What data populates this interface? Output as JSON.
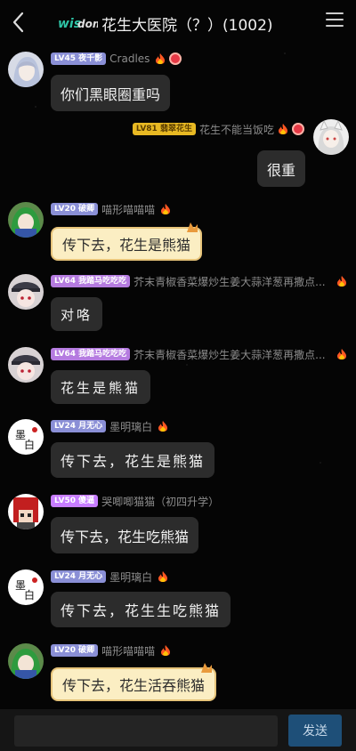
{
  "header": {
    "title": "花生大医院（？）(1002)",
    "logo_text": "wisdom"
  },
  "messages": [
    {
      "side": "left",
      "level": "LV45",
      "level_color": "#8a8fd6",
      "nick": "夜千影",
      "remark": "Cradles",
      "text": "你们黑眼圈重吗",
      "fire": true,
      "badge": true,
      "avatar": "avatar-girl-silver"
    },
    {
      "side": "right",
      "level": "LV81",
      "level_color": "#e8b923",
      "nick": "翡翠花生",
      "remark": "花生不能当饭吃",
      "text": "很重",
      "fire": true,
      "badge": true,
      "avatar": "avatar-catgirl-white"
    },
    {
      "side": "left",
      "level": "LV20",
      "level_color": "#8a8fd6",
      "nick": "破卿",
      "remark": "喵形喵喵喵",
      "text": "传下去，花生是熊猫",
      "fire": true,
      "badge": false,
      "avatar": "avatar-green-hair",
      "style": "cat"
    },
    {
      "side": "left",
      "level": "LV64",
      "level_color": "#b57be0",
      "nick": "我踏马吃吃吃",
      "remark": "芥末青椒香菜爆炒生姜大蒜洋葱再撒点...",
      "text": "对咯",
      "fire": true,
      "badge": false,
      "avatar": "avatar-cap-girl",
      "style": "hand"
    },
    {
      "side": "left",
      "level": "LV64",
      "level_color": "#b57be0",
      "nick": "我踏马吃吃吃",
      "remark": "芥末青椒香菜爆炒生姜大蒜洋葱再撒点...",
      "text": "花生是熊猫",
      "fire": true,
      "badge": false,
      "avatar": "avatar-cap-girl",
      "style": "hand"
    },
    {
      "side": "left",
      "level": "LV24",
      "level_color": "#8a8fd6",
      "nick": "月无心",
      "remark": "墨明璃白",
      "text": "传下去，花生是熊猫",
      "fire": true,
      "badge": false,
      "avatar": "avatar-ink-white",
      "style": "wide"
    },
    {
      "side": "left",
      "level": "LV50",
      "level_color": "#c77dff",
      "nick": "傻逼",
      "remark": "哭唧唧猫猫（初四升学）",
      "text": "传下去，花生吃熊猫",
      "fire": false,
      "badge": false,
      "avatar": "avatar-red-hair"
    },
    {
      "side": "left",
      "level": "LV24",
      "level_color": "#8a8fd6",
      "nick": "月无心",
      "remark": "墨明璃白",
      "text": "传下去，花生生吃熊猫",
      "fire": true,
      "badge": false,
      "avatar": "avatar-ink-white",
      "style": "wide"
    },
    {
      "side": "left",
      "level": "LV20",
      "level_color": "#8a8fd6",
      "nick": "破卿",
      "remark": "喵形喵喵喵",
      "text": "传下去，花生活吞熊猫",
      "fire": true,
      "badge": false,
      "avatar": "avatar-green-hair",
      "style": "cat"
    }
  ],
  "footer": {
    "input_placeholder": "",
    "send_label": "发送"
  }
}
